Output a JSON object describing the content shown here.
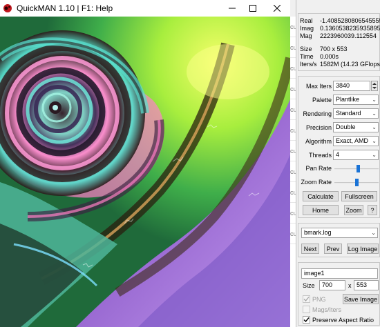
{
  "window": {
    "title": "QuickMAN 1.10  |  F1: Help",
    "minimize_icon": "minimize-icon",
    "maximize_icon": "maximize-icon",
    "close_icon": "close-icon"
  },
  "info": {
    "real_label": "Real",
    "real_value": "-1.4085280806545555",
    "imag_label": "Imag",
    "imag_value": "0.1360538235935895",
    "mag_label": "Mag",
    "mag_value": "2223960039.112554",
    "size_label": "Size",
    "size_value": "700 x 553",
    "time_label": "Time",
    "time_value": "0.000s",
    "iters_label": "Iters/s",
    "iters_value": "1582M (14.23 GFlops)"
  },
  "settings": {
    "max_iters_label": "Max Iters",
    "max_iters_value": "3840",
    "palette_label": "Palette",
    "palette_value": "Plantlike",
    "rendering_label": "Rendering",
    "rendering_value": "Standard",
    "precision_label": "Precision",
    "precision_value": "Double",
    "algorithm_label": "Algorithm",
    "algorithm_value": "Exact, AMD",
    "threads_label": "Threads",
    "threads_value": "4",
    "pan_rate_label": "Pan Rate",
    "pan_rate_level": 0.55,
    "zoom_rate_label": "Zoom Rate",
    "zoom_rate_level": 0.5
  },
  "actions": {
    "calculate": "Calculate",
    "fullscreen": "Fullscreen",
    "home": "Home",
    "zoom": "Zoom",
    "help": "?"
  },
  "log": {
    "file_value": "bmark.log",
    "next": "Next",
    "prev": "Prev",
    "log_image": "Log Image"
  },
  "save": {
    "name_value": "image1",
    "size_label": "Size",
    "width_value": "700",
    "x_label": "x",
    "height_value": "553",
    "png_label": "PNG",
    "mags_label": "Mags/Iters",
    "save_image": "Save Image",
    "aspect_label": "Preserve Aspect Ratio",
    "aspect_checked": true
  },
  "edge_text": [
    "cu",
    "cu",
    "cu",
    "cu",
    "cu",
    "cu",
    "cu",
    "cu",
    "cu",
    "cu",
    "cu"
  ],
  "colors": {
    "accent": "#1a73d6",
    "app_icon": "#c0171d"
  }
}
